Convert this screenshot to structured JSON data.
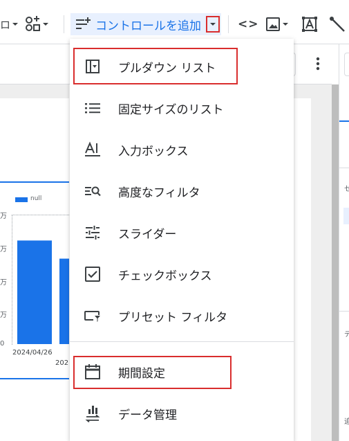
{
  "toolbar": {
    "partial_label": "ロ",
    "add_control_label": "コントロールを追加",
    "code_symbol": "<>"
  },
  "chart_data": {
    "type": "bar",
    "categories": [
      "2024/04/26",
      "202"
    ],
    "series": [
      {
        "name": "null",
        "values": [
          4,
          3.3
        ]
      }
    ],
    "ylim": [
      0,
      5
    ],
    "ytick_labels": [
      "0",
      "万",
      "万",
      "万",
      "万"
    ]
  },
  "menu": {
    "items": [
      {
        "label": "プルダウン リスト",
        "icon": "dropdown-list-icon"
      },
      {
        "label": "固定サイズのリスト",
        "icon": "list-icon"
      },
      {
        "label": "入力ボックス",
        "icon": "input-box-icon"
      },
      {
        "label": "高度なフィルタ",
        "icon": "advanced-filter-icon"
      },
      {
        "label": "スライダー",
        "icon": "slider-icon"
      },
      {
        "label": "チェックボックス",
        "icon": "checkbox-icon"
      },
      {
        "label": "プリセット フィルタ",
        "icon": "preset-filter-icon"
      },
      {
        "label": "期間設定",
        "icon": "calendar-icon"
      },
      {
        "label": "データ管理",
        "icon": "data-control-icon"
      }
    ]
  },
  "right_panel": {
    "frag1": "セ",
    "frag2": "デ",
    "frag3": "追"
  },
  "colors": {
    "accent": "#1a73e8",
    "highlight": "#d92d2d"
  }
}
